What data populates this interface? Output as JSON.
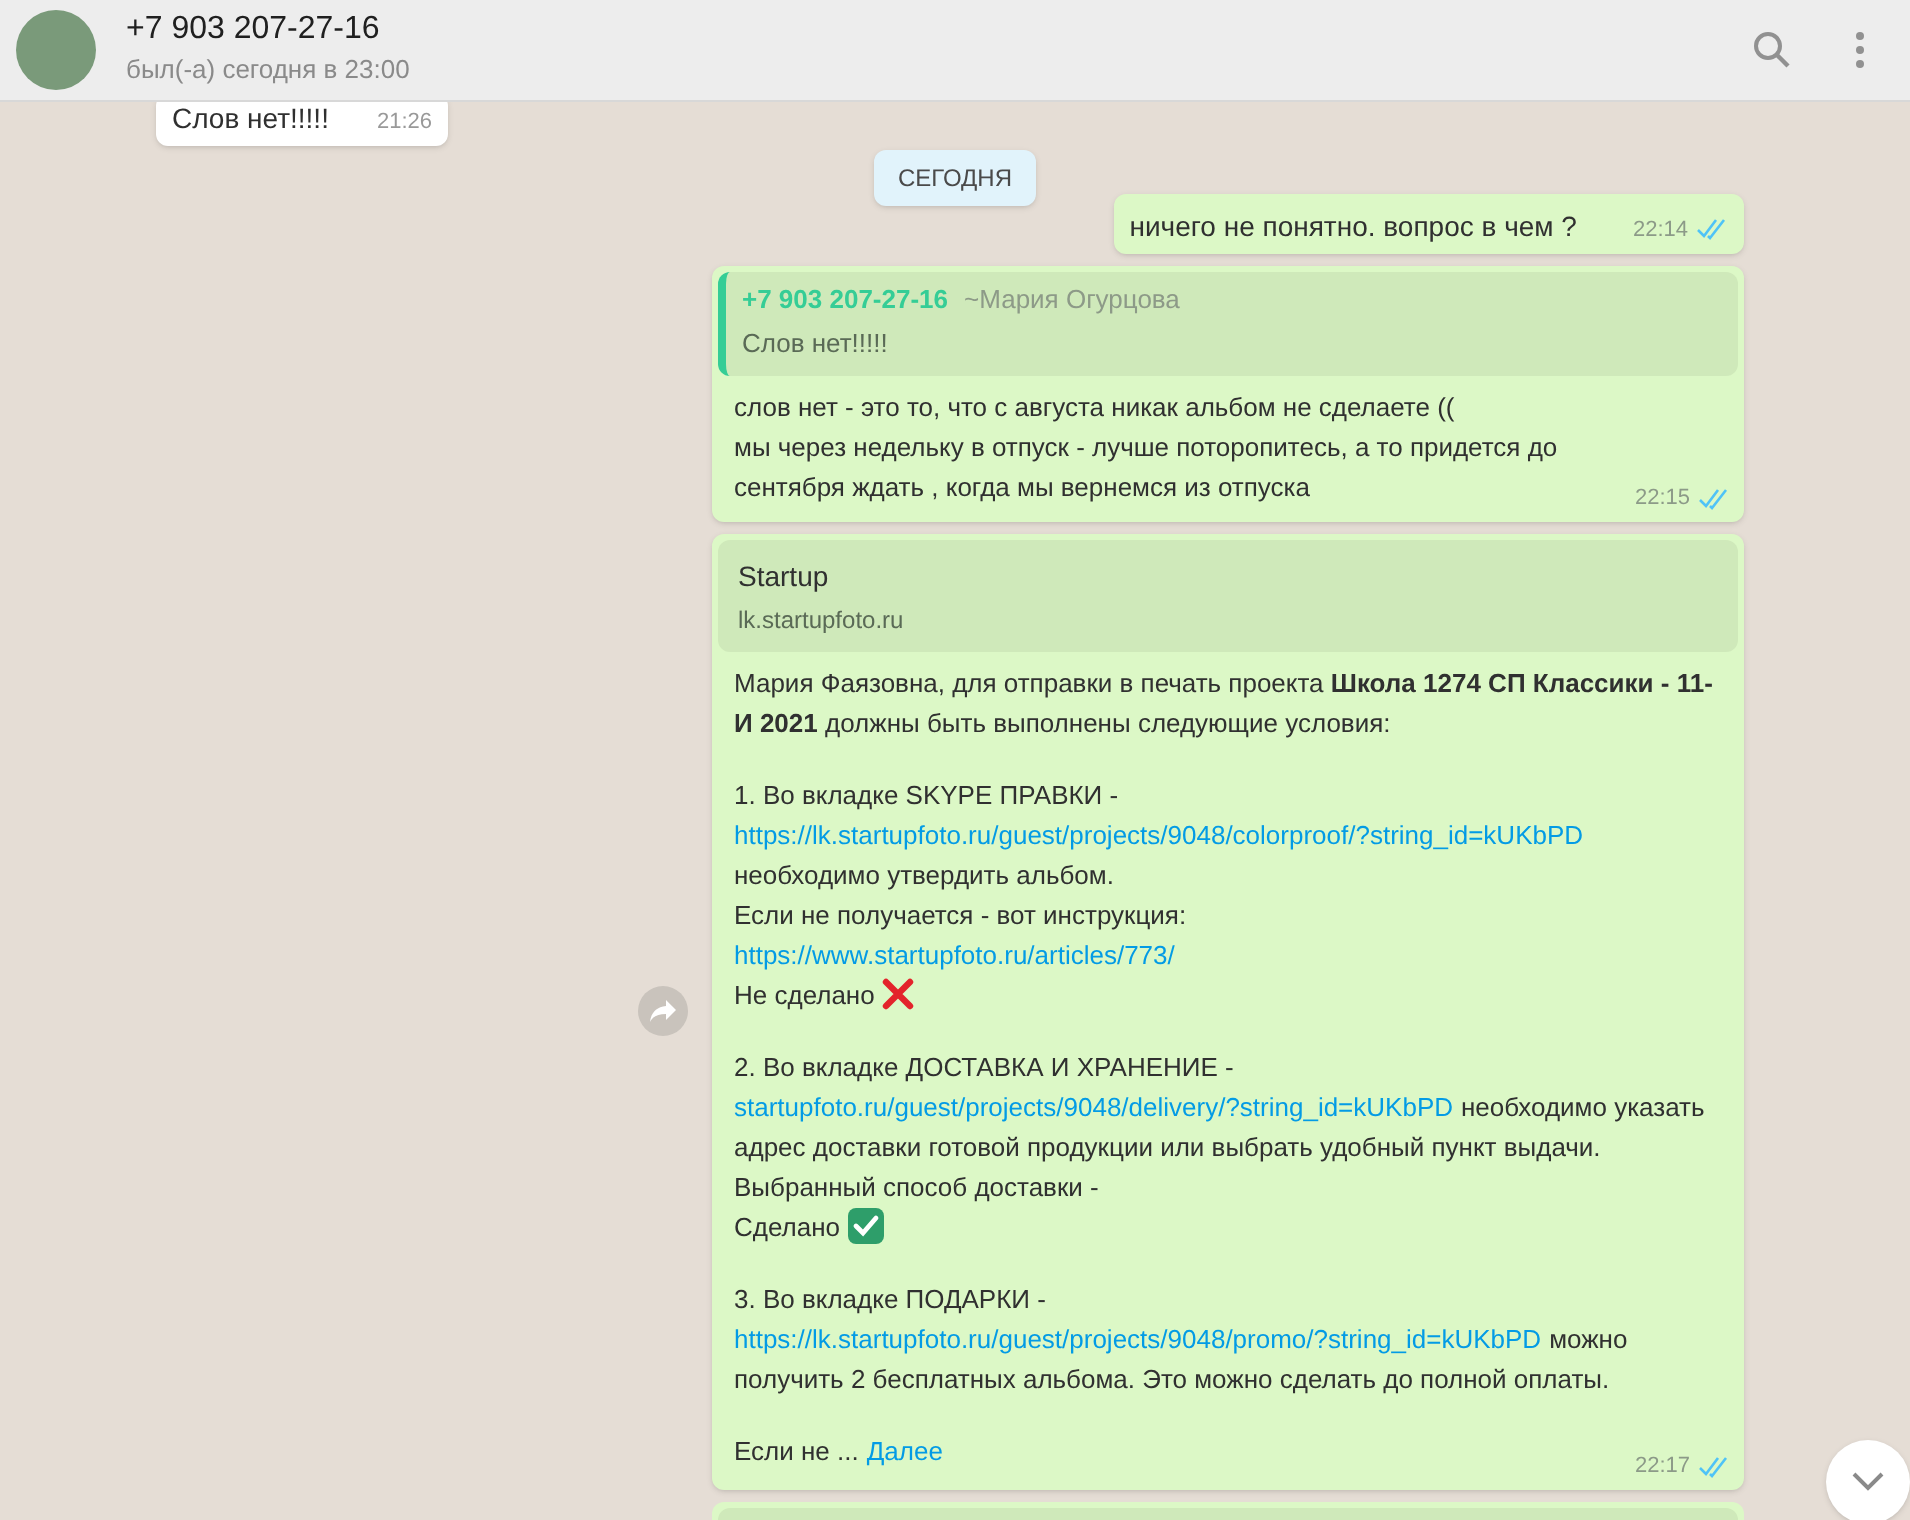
{
  "header": {
    "name": "+7 903 207-27-16",
    "status": "был(-а) сегодня в 23:00"
  },
  "messages": [
    {
      "kind": "incoming",
      "text": "Слов нет!!!!!",
      "time": "21:26"
    },
    {
      "kind": "date",
      "text": "СЕГОДНЯ"
    },
    {
      "kind": "outgoing",
      "text": "ничего не понятно. вопрос в чем ?",
      "time": "22:14",
      "read": true
    },
    {
      "kind": "reply",
      "quote": {
        "author": "+7 903 207-27-16",
        "name": "~Мария Огурцова",
        "text": "Слов нет!!!!!"
      },
      "lines": [
        "слов нет - это то, что с августа никак альбом не сделаете ((",
        "мы через недельку в отпуск - лучше поторопитесь, а то придется до сентября ждать , когда мы вернемся из отпуска"
      ],
      "time": "22:15",
      "read": true
    },
    {
      "kind": "link",
      "forward": true,
      "preview": {
        "title": "Startup",
        "url": "lk.startupfoto.ru"
      },
      "paragraphs": [
        [
          [
            {
              "kind": "text",
              "text": "Мария  Фаязовна, для отправки в печать проекта **Школа  1274 СП Классики - 11-И 2021** должны быть выполнены следующие условия:"
            }
          ]
        ],
        [
          [
            {
              "kind": "text",
              "text": "1. Во вкладке SKYPE ПРАВКИ -"
            }
          ],
          [
            {
              "kind": "link",
              "text": "https://lk.startupfoto.ru/guest/projects/9048/colorproof/?string_id=kUKbPD"
            }
          ],
          [
            {
              "kind": "text",
              "text": "необходимо утвердить альбом."
            }
          ],
          [
            {
              "kind": "text",
              "text": "Если не получается - вот инструкция:"
            }
          ],
          [
            {
              "kind": "link",
              "text": "https://www.startupfoto.ru/articles/773/"
            }
          ],
          [
            {
              "kind": "text",
              "text": "Не сделано"
            },
            {
              "kind": "cross"
            }
          ]
        ],
        [
          [
            {
              "kind": "text",
              "text": "2. Во вкладке ДОСТАВКА И ХРАНЕНИЕ -"
            }
          ],
          [
            {
              "kind": "link",
              "text": "startupfoto.ru/guest/projects/9048/delivery/?string_id=kUKbPD"
            },
            {
              "kind": "text",
              "text": "необходимо указать адрес доставки готовой продукции или выбрать удобный пункт выдачи."
            }
          ],
          [
            {
              "kind": "text",
              "text": "Выбранный способ доставки -"
            }
          ],
          [
            {
              "kind": "text",
              "text": "Сделано"
            },
            {
              "kind": "check"
            }
          ]
        ],
        [
          [
            {
              "kind": "text",
              "text": "3. Во вкладке ПОДАРКИ -"
            }
          ],
          [
            {
              "kind": "link",
              "text": "https://lk.startupfoto.ru/guest/projects/9048/promo/?string_id=kUKbPD"
            },
            {
              "kind": "text",
              "text": "можно получить 2 бесплатных альбома. Это можно сделать до полной оплаты."
            }
          ]
        ],
        [
          [
            {
              "kind": "text",
              "text": "Если не ..."
            },
            {
              "kind": "link",
              "text": "Далее"
            }
          ]
        ]
      ],
      "time": "22:17",
      "read": true
    },
    {
      "kind": "stub"
    }
  ]
}
